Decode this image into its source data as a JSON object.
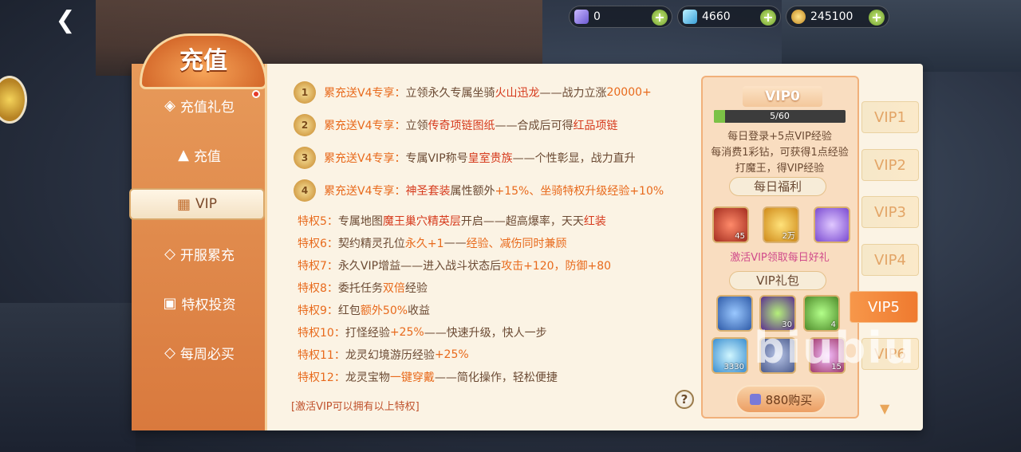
{
  "currency": [
    {
      "icon": "purple-gem-icon",
      "value": "0"
    },
    {
      "icon": "diamond-icon",
      "value": "4660"
    },
    {
      "icon": "gold-coin-icon",
      "value": "245100"
    }
  ],
  "title": "充值",
  "sidebar": {
    "items": [
      {
        "icon": "gift-pack-icon",
        "label": "充值礼包"
      },
      {
        "icon": "recharge-icon",
        "label": "充值"
      },
      {
        "icon": "calendar-icon",
        "label": "VIP"
      },
      {
        "icon": "server-recharge-icon",
        "label": "开服累充"
      },
      {
        "icon": "gift-box-icon",
        "label": "特权投资"
      },
      {
        "icon": "weekly-icon",
        "label": "每周必买"
      }
    ]
  },
  "privileges": {
    "medal_rows": [
      {
        "num": "1",
        "prefix": "累充送V4专享：",
        "text": "立领永久专属坐骑",
        "hl": "火山迅龙",
        "rest": "——战力立涨",
        "tail": "20000+"
      },
      {
        "num": "2",
        "prefix": "累充送V4专享：",
        "text": "立领",
        "hl": "传奇项链图纸",
        "rest": "——合成后可得",
        "tail": "红品项链"
      },
      {
        "num": "3",
        "prefix": "累充送V4专享：",
        "text": "专属VIP称号",
        "hl": "皇室贵族",
        "rest": "——个性彰显，战力直升",
        "tail": ""
      },
      {
        "num": "4",
        "prefix": "累充送V4专享：",
        "text": "",
        "hl": "神圣套装",
        "rest": "属性额外",
        "tail": "+15%、坐骑特权升级经验+10%"
      }
    ],
    "rows": [
      {
        "key": "特权5：",
        "a": "专属地图",
        "b": "魔王巢穴精英层",
        "c": "开启——超高爆率，天天",
        "d": "红装"
      },
      {
        "key": "特权6：",
        "a": "契约精灵孔位",
        "b": "永久+1",
        "c": "——",
        "d": "经验、减伤同时兼顾"
      },
      {
        "key": "特权7：",
        "a": "永久VIP增益——进入战斗状态后",
        "b": "攻击+120，防御+80",
        "c": "",
        "d": ""
      },
      {
        "key": "特权8：",
        "a": "委托任务",
        "b": "双倍",
        "c": "经验",
        "d": ""
      },
      {
        "key": "特权9：",
        "a": "红包",
        "b": "额外50%",
        "c": "收益",
        "d": ""
      },
      {
        "key": "特权10：",
        "a": "打怪经验",
        "b": "+25%",
        "c": "——快速升级，快人一步",
        "d": ""
      },
      {
        "key": "特权11：",
        "a": "龙灵幻境游历经验",
        "b": "+25%",
        "c": "",
        "d": ""
      },
      {
        "key": "特权12：",
        "a": "龙灵宝物",
        "b": "一键穿戴",
        "c": "——简化操作，轻松便捷",
        "d": ""
      }
    ],
    "note": "[激活VIP可以拥有以上特权]",
    "help": "?"
  },
  "vip_card": {
    "level": "VIP0",
    "progress_text": "5/60",
    "progress_fraction": 0.0833,
    "line1": "每日登录+5点VIP经验",
    "line2": "每消费1彩钻，可获得1点经验",
    "line3": "打魔王，得VIP经验",
    "daily_title": "每日福利",
    "daily_items": [
      {
        "icon": "red-orb-icon",
        "count": "45"
      },
      {
        "icon": "gold-star-icon",
        "count": "2万"
      },
      {
        "icon": "purple-pouch-icon",
        "count": ""
      }
    ],
    "activate_text": "激活VIP领取每日好礼",
    "pack_title": "VIP礼包",
    "pack_items": [
      {
        "icon": "blue-book-icon",
        "count": ""
      },
      {
        "icon": "green-potion-icon",
        "count": "30"
      },
      {
        "icon": "green-flask-icon",
        "count": "4"
      },
      {
        "icon": "blue-crystal-icon",
        "count": "3330"
      },
      {
        "icon": "treasure-chest-icon",
        "count": ""
      },
      {
        "icon": "scroll-icon",
        "count": "15"
      }
    ],
    "buy_label": "880购买"
  },
  "vip_tabs": [
    "VIP1",
    "VIP2",
    "VIP3",
    "VIP4",
    "VIP5",
    "VIP6"
  ],
  "active_tab": "VIP5",
  "watermark": "biubiu",
  "colors": {
    "accent": "#e86a1c",
    "panel": "#fbf3e4",
    "sidebar": "#e08a4a"
  }
}
